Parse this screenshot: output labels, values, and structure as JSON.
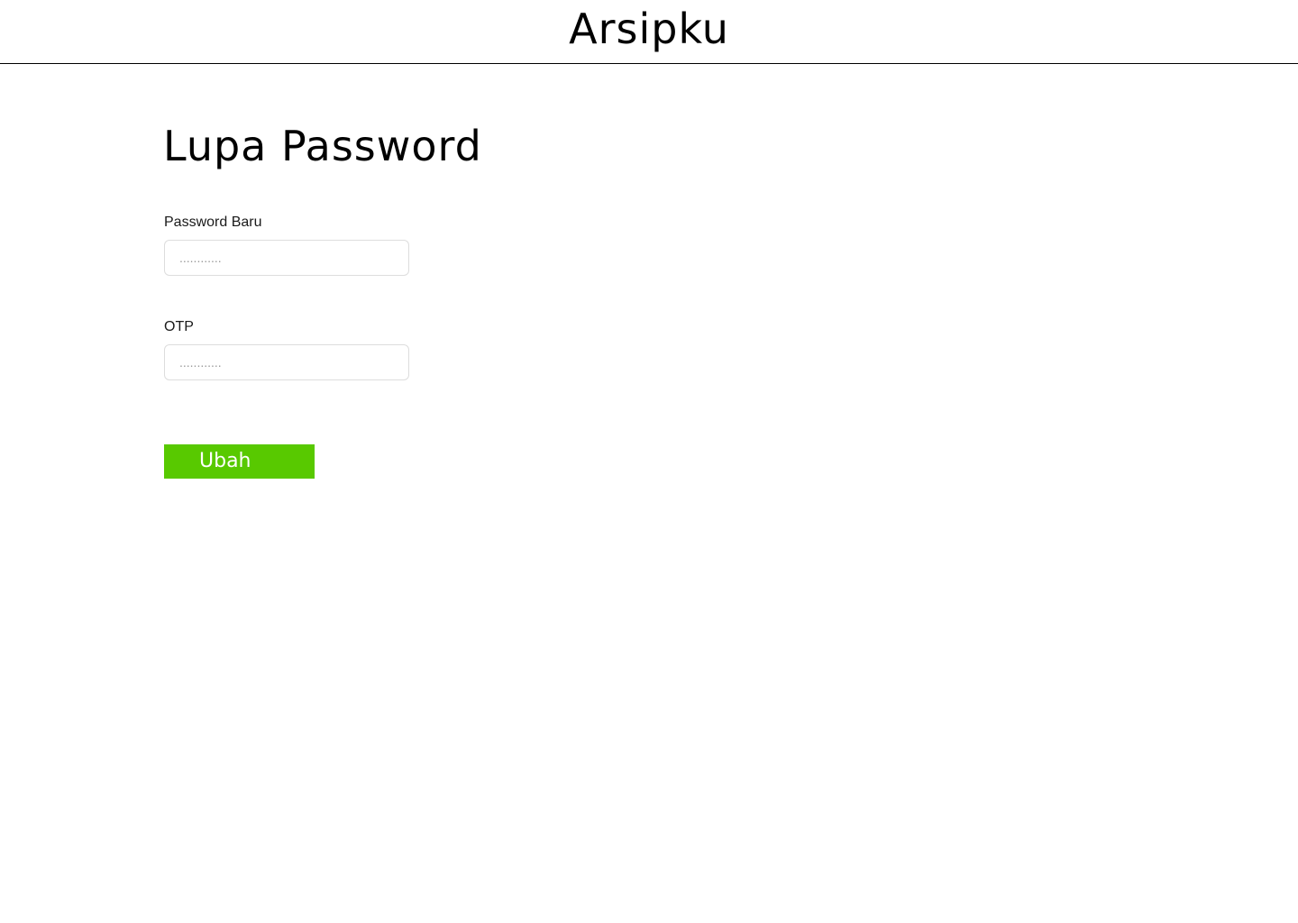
{
  "header": {
    "app_title": "Arsipku"
  },
  "page": {
    "title": "Lupa Password"
  },
  "form": {
    "new_password": {
      "label": "Password Baru",
      "placeholder": "............",
      "value": ""
    },
    "otp": {
      "label": "OTP",
      "placeholder": "............",
      "value": ""
    },
    "submit_label": "Ubah"
  },
  "colors": {
    "accent": "#58c900",
    "header_rule": "#000000",
    "input_border": "#dddddd"
  }
}
